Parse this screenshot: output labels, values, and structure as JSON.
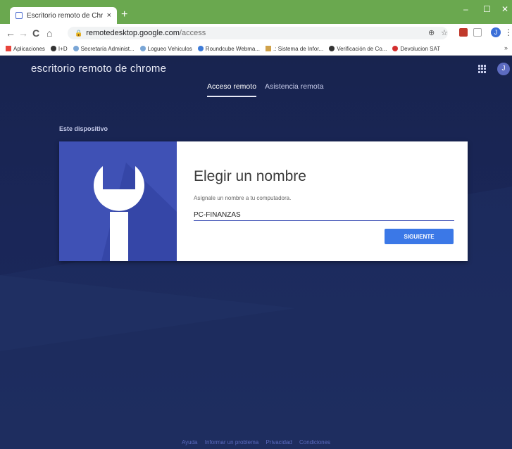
{
  "browser": {
    "tab_title": "Escritorio remoto de Chrome",
    "tab_close": "×",
    "new_tab": "+",
    "minimize": "–",
    "maximize": "☐",
    "close": "✕",
    "url_host": "remotedesktop.google.com",
    "url_path": "/access",
    "back_icon": "←",
    "forward_icon": "→",
    "reload_icon": "C",
    "home_icon": "⌂",
    "avatar_letter": "J",
    "bookmarks": [
      {
        "label": "Aplicaciones",
        "color": "#e8453c"
      },
      {
        "label": "I+D",
        "color": "#333333"
      },
      {
        "label": "Secretaría Administ...",
        "color": "#7aa6d6"
      },
      {
        "label": "Logueo Vehiculos",
        "color": "#7aa6d6"
      },
      {
        "label": "Roundcube Webma...",
        "color": "#3d7bd8"
      },
      {
        "label": ".: Sistema de Infor...",
        "color": "#d0a24b"
      },
      {
        "label": "Verificación de Co...",
        "color": "#333333"
      },
      {
        "label": "Devolucion SAT",
        "color": "#d32f2f"
      }
    ],
    "bookmarks_more": "»"
  },
  "app": {
    "brand": "escritorio remoto de chrome",
    "user_initial": "J",
    "tabs": [
      {
        "label": "Acceso remoto",
        "active": true
      },
      {
        "label": "Asistencia remota",
        "active": false
      }
    ],
    "section_label": "Este dispositivo",
    "dialog": {
      "title": "Elegir un nombre",
      "subtitle": "Asígnale un nombre a tu computadora.",
      "input_value": "PC-FINANZAS",
      "next_label": "SIGUIENTE"
    },
    "footer": [
      "Ayuda",
      "Informar un problema",
      "Privacidad",
      "Condiciones"
    ]
  },
  "colors": {
    "accent": "#3f51b5",
    "button": "#3b78e7",
    "background": "#1a2557"
  }
}
